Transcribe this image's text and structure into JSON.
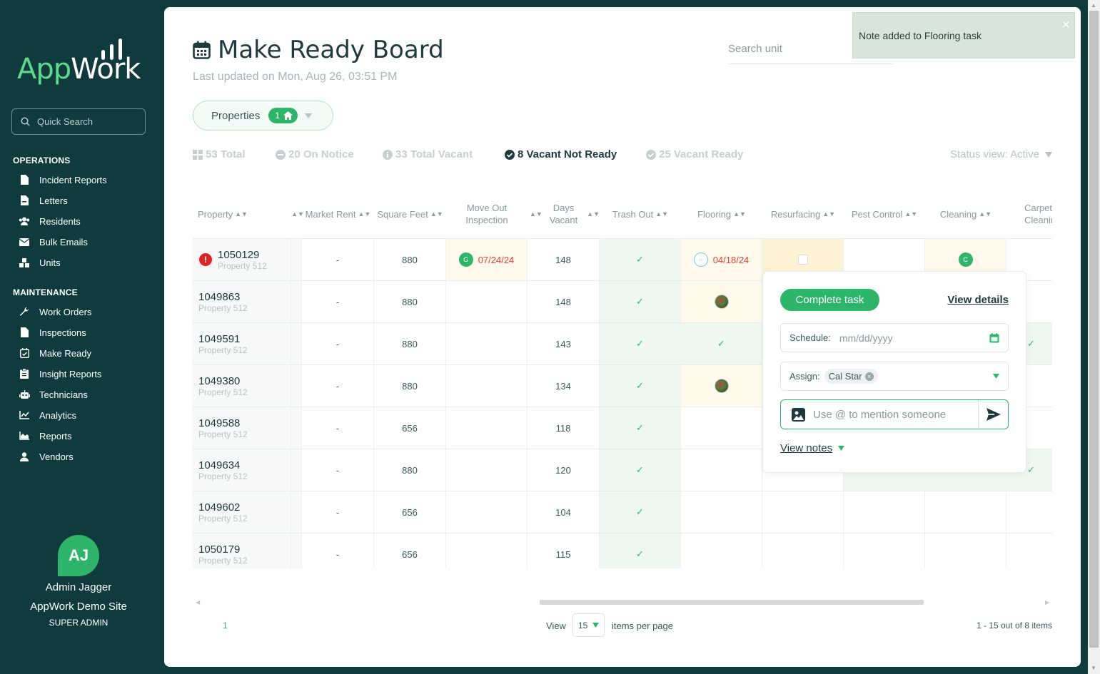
{
  "brand": {
    "logo_text_app": "App",
    "logo_text_work": "Work"
  },
  "sidebar": {
    "search_placeholder": "Quick Search",
    "sections": [
      {
        "title": "OPERATIONS",
        "items": [
          {
            "label": "Incident Reports",
            "icon": "document-icon"
          },
          {
            "label": "Letters",
            "icon": "letter-icon"
          },
          {
            "label": "Residents",
            "icon": "users-icon"
          },
          {
            "label": "Bulk Emails",
            "icon": "mail-icon"
          },
          {
            "label": "Units",
            "icon": "units-icon"
          }
        ]
      },
      {
        "title": "MAINTENANCE",
        "items": [
          {
            "label": "Work Orders",
            "icon": "wrench-icon"
          },
          {
            "label": "Inspections",
            "icon": "document-icon"
          },
          {
            "label": "Make Ready",
            "icon": "calendar-check-icon"
          },
          {
            "label": "Insight Reports",
            "icon": "clipboard-icon"
          },
          {
            "label": "Technicians",
            "icon": "robot-icon"
          },
          {
            "label": "Analytics",
            "icon": "line-chart-icon"
          },
          {
            "label": "Reports",
            "icon": "area-chart-icon"
          },
          {
            "label": "Vendors",
            "icon": "user-icon"
          }
        ]
      }
    ],
    "user": {
      "initials": "AJ",
      "name": "Admin Jagger",
      "site": "AppWork Demo Site",
      "role": "SUPER ADMIN"
    }
  },
  "header": {
    "title": "Make Ready Board",
    "last_updated": "Last updated on Mon, Aug 26, 03:51 PM",
    "search_placeholder": "Search unit"
  },
  "filter": {
    "label": "Properties",
    "count": "1"
  },
  "stats": [
    {
      "label": "53 Total",
      "active": false
    },
    {
      "label": "20 On Notice",
      "active": false
    },
    {
      "label": "33 Total Vacant",
      "active": false
    },
    {
      "label": "8 Vacant Not Ready",
      "active": true
    },
    {
      "label": "25 Vacant Ready",
      "active": false
    }
  ],
  "status_view": "Status view: Active",
  "table": {
    "columns": [
      "Property",
      "Market Rent",
      "Square Feet",
      "Move Out Inspection",
      "Days Vacant",
      "Trash Out",
      "Flooring",
      "Resurfacing",
      "Pest Control",
      "Cleaning",
      "Carpet Cleaning"
    ],
    "rows": [
      {
        "unit": "1050129",
        "property": "Property 512",
        "rent": "-",
        "sqft": "880",
        "moveout": "07/24/24",
        "moveout_badge": "G",
        "days": "148",
        "flooring": "04/18/24",
        "cleaning_badge": "C"
      },
      {
        "unit": "1049863",
        "property": "Property 512",
        "rent": "-",
        "sqft": "880",
        "days": "148"
      },
      {
        "unit": "1049591",
        "property": "Property 512",
        "rent": "-",
        "sqft": "880",
        "days": "143"
      },
      {
        "unit": "1049380",
        "property": "Property 512",
        "rent": "-",
        "sqft": "880",
        "days": "134"
      },
      {
        "unit": "1049588",
        "property": "Property 512",
        "rent": "-",
        "sqft": "656",
        "days": "118"
      },
      {
        "unit": "1049634",
        "property": "Property 512",
        "rent": "-",
        "sqft": "880",
        "days": "120"
      },
      {
        "unit": "1049602",
        "property": "Property 512",
        "rent": "-",
        "sqft": "656",
        "days": "104"
      },
      {
        "unit": "1050179",
        "property": "Property 512",
        "rent": "-",
        "sqft": "656",
        "days": "115"
      }
    ]
  },
  "popover": {
    "complete_label": "Complete task",
    "details_label": "View details",
    "schedule_label": "Schedule:",
    "schedule_placeholder": "mm/dd/yyyy",
    "assign_label": "Assign:",
    "assignee": "Cal Star",
    "note_placeholder": "Use @ to mention someone",
    "view_notes": "View notes"
  },
  "pagination": {
    "page": "1",
    "view_label": "View",
    "per_page": "15",
    "items_label": "items per page",
    "count": "1 - 15 out of 8 items"
  },
  "toast": {
    "message": "Note added to Flooring task"
  },
  "colors": {
    "brand_green": "#2db56a",
    "sidebar_bg": "#0f3b3f",
    "alert_red": "#e02424"
  }
}
